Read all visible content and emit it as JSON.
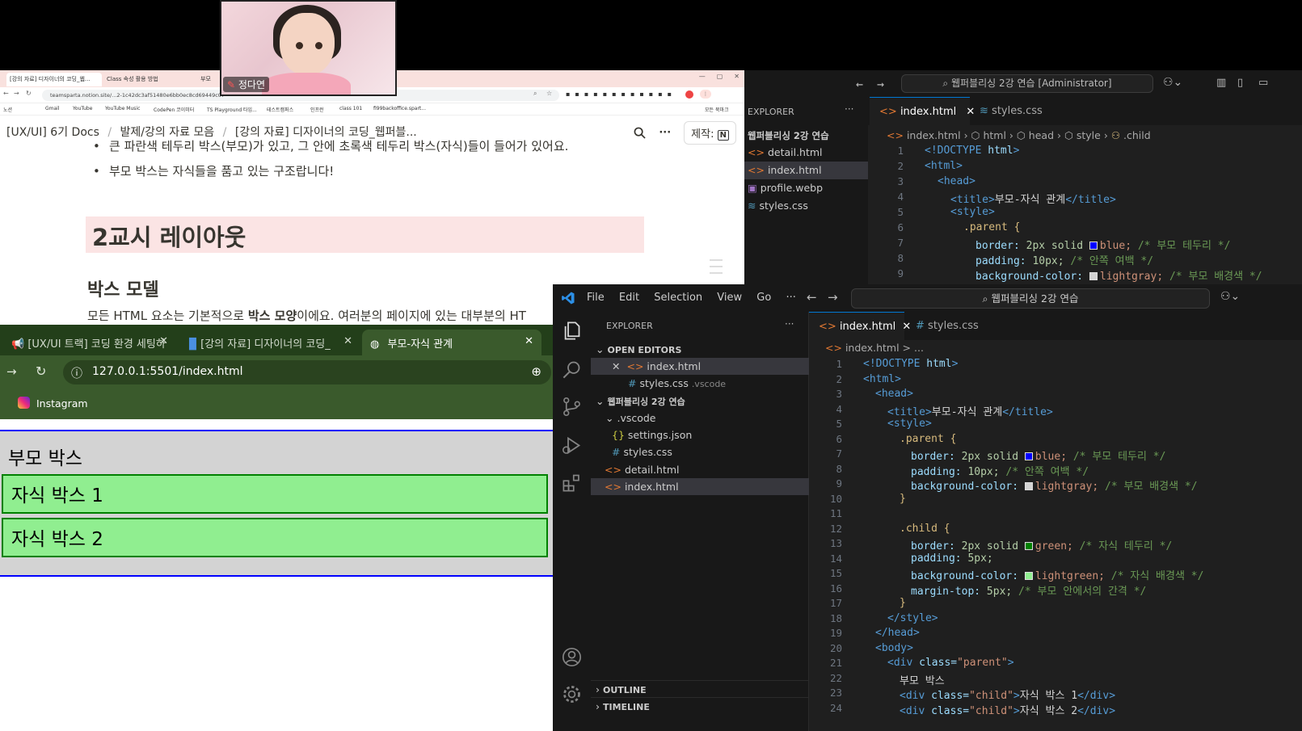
{
  "webcam": {
    "name": "정다연"
  },
  "notion": {
    "tabs": [
      "[강의 자료] 디자이너의 코딩_웹...",
      "Class 속성 활용 방법",
      "부모"
    ],
    "url": "teamsparta.notion.site/...2-1c42dc3af51480e6bb0ec8cd69449c07",
    "bookmarks": [
      "노션",
      "Gmail",
      "YouTube",
      "YouTube Music",
      "CodePen 코이미터",
      "TS Playground 타입...",
      "테스트캠퍼스",
      "인프런",
      "class 101",
      "fi99backoffice.spart..."
    ],
    "other_bookmarks": "모든 북마크",
    "breadcrumb": [
      "[UX/UI] 6기 Docs",
      "/",
      "발제/강의 자료 모음",
      "/",
      "[강의 자료] 디자이너의 코딩_웹퍼블..."
    ],
    "share_label": "제작:",
    "bullet_1": "큰 파란색 테두리 박스(부모)가 있고, 그 안에 초록색 테두리 박스(자식)들이 들어가 있어요.",
    "bullet_2": "부모 박스는 자식들을 품고 있는 구조랍니다!",
    "heading": "2교시 레이아웃",
    "subheading": "박스 모델",
    "para_pre": "모든 HTML 요소는 기본적으로 ",
    "para_bold": "박스 모양",
    "para_post": "이에요. 여러분의 페이지에 있는 대부분의 HT"
  },
  "vscode_top": {
    "search": "웹퍼블리싱 2강 연습 [Administrator]",
    "explorer_label": "EXPLORER",
    "folder": "웹퍼블리싱 2강 연습",
    "files": [
      "detail.html",
      "index.html",
      "profile.webp",
      "styles.css"
    ],
    "tabs": [
      "index.html",
      "styles.css"
    ],
    "breadcrumb": [
      "index.html",
      "html",
      "head",
      "style",
      ".child"
    ],
    "line_numbers": [
      "1",
      "2",
      "3",
      "4",
      "5",
      "6",
      "7",
      "8",
      "9"
    ]
  },
  "browser": {
    "tabs": [
      "[UX/UI 트랙] 코딩 환경 세팅하",
      "[강의 자료] 디자이너의 코딩_",
      "부모-자식 관계"
    ],
    "url": "127.0.0.1:5501/index.html",
    "bookmark": "Instagram",
    "parent_text": "부모 박스",
    "child_1": "자식 박스 1",
    "child_2": "자식 박스 2",
    "colors": {
      "parent_border": "#0000ff",
      "parent_bg": "#d3d3d3",
      "child_border": "#008000",
      "child_bg": "#90ee90",
      "tab_bar": "#233f1a"
    }
  },
  "vscode_main": {
    "menu": [
      "File",
      "Edit",
      "Selection",
      "View",
      "Go",
      "···"
    ],
    "search": "웹퍼블리싱 2강 연습",
    "explorer_label": "EXPLORER",
    "open_editors_label": "OPEN EDITORS",
    "open_editors": [
      {
        "name": "index.html",
        "hint": ""
      },
      {
        "name": "styles.css",
        "hint": ".vscode"
      }
    ],
    "folder": "웹퍼블리싱 2강 연습",
    "tree": [
      ".vscode",
      "settings.json",
      "styles.css",
      "detail.html",
      "index.html"
    ],
    "outline_label": "OUTLINE",
    "timeline_label": "TIMELINE",
    "tabs": [
      "index.html",
      "styles.css"
    ],
    "breadcrumb": "index.html > ...",
    "line_numbers": [
      "1",
      "2",
      "3",
      "4",
      "5",
      "6",
      "7",
      "8",
      "9",
      "10",
      "11",
      "12",
      "13",
      "14",
      "15",
      "16",
      "17",
      "18",
      "19",
      "20",
      "21",
      "22",
      "23",
      "24"
    ]
  },
  "code": {
    "doctype_kw": "<!DOCTYPE",
    "doctype_html": " html",
    "html_open": "<html>",
    "head_open": "<head>",
    "title_open": "<title>",
    "title_text": "부모-자식 관계",
    "title_close": "</title>",
    "style_open": "<style>",
    "parent_sel": ".parent {",
    "prop_border": "border:",
    "val_2px_solid": " 2px solid ",
    "val_blue": "blue;",
    "cm_parent_border": " /* 부모 테두리 */",
    "prop_padding": "padding:",
    "val_10px": " 10px;",
    "cm_padding": " /* 안쪽 여백 */",
    "prop_bg": "background-color:",
    "val_lightgray": "lightgray;",
    "cm_parent_bg": " /* 부모 배경색 */",
    "close_brace": "}",
    "child_sel": ".child {",
    "val_green": "green;",
    "cm_child_border": " /* 자식 테두리 */",
    "val_5px": " 5px;",
    "val_lightgreen": "lightgreen;",
    "cm_child_bg": " /* 자식 배경색 */",
    "prop_margin": "margin-top:",
    "cm_margin": " /* 부모 안에서의 간격 */",
    "style_close": "</style>",
    "head_close": "</head>",
    "body_open": "<body>",
    "div_open": "<div",
    "attr_class": " class=",
    "val_parent": "\"parent\"",
    "gt": ">",
    "text_parent": "부모 박스",
    "val_child": "\"child\"",
    "text_child1": "자식 박스 1",
    "text_child2": "자식 박스 2",
    "div_close": "</div>"
  }
}
